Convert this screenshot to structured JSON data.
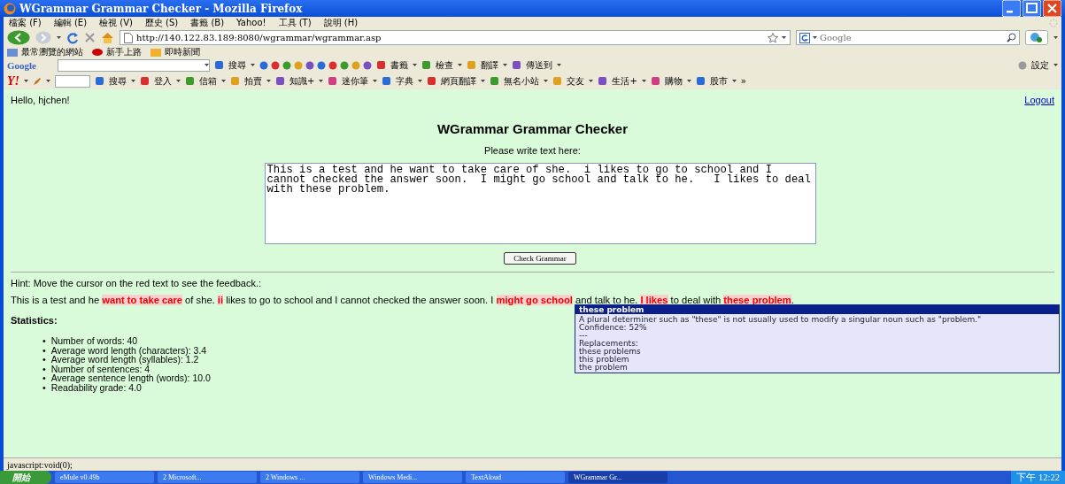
{
  "window": {
    "title": "WGrammar Grammar Checker - Mozilla Firefox"
  },
  "menu": [
    "檔案 (F)",
    "編輯 (E)",
    "檢視 (V)",
    "歷史 (S)",
    "書籤 (B)",
    "Yahoo!",
    "工具 (T)",
    "說明 (H)"
  ],
  "address_bar": {
    "url": "http://140.122.83.189:8080/wgrammar/wgrammar.asp"
  },
  "search_box": {
    "placeholder": "Google"
  },
  "bookmarks": [
    "最常瀏覽的網站",
    "新手上路",
    "即時新聞"
  ],
  "google_toolbar": {
    "logo": "Google",
    "items": [
      "搜尋",
      "書籤",
      "檢查",
      "翻譯",
      "傳送到"
    ],
    "settings": "設定"
  },
  "yahoo_toolbar": {
    "logo": "Y!",
    "items": [
      "搜尋",
      "登入",
      "信箱",
      "拍賣",
      "知識+",
      "迷你筆",
      "字典",
      "網頁翻譯",
      "無名小站",
      "交友",
      "生活+",
      "購物",
      "股市"
    ],
    "more": "»"
  },
  "page": {
    "greeting": "Hello, hjchen!",
    "logout": "Logout",
    "heading": "WGrammar Grammar Checker",
    "prompt": "Please write text here:",
    "input_text": "This is a test and he want to take care of she.  i likes to go to school and I cannot checked the answer soon.  I might go school and talk to he.   I likes to deal with these problem.",
    "button": "Check Grammar",
    "hint": "Hint: Move the cursor on the red text to see the feedback.:",
    "result": "This is a test and he **want to take care** of she. **ii** likes to go to school and I cannot checked the answer soon. I **might go school** and talk to he. **I likes** to deal with **these problem**.",
    "statistics_title": "Statistics:",
    "bullet": "•",
    "statistics": [
      "Number of words: 40",
      "Average word length (characters): 3.4",
      "Average word length (syllables): 1.2",
      "Number of sentences: 4",
      "Average sentence length (words): 10.0",
      "Readability grade: 4.0"
    ]
  },
  "tooltip": {
    "title": "these problem",
    "message": "A plural determiner such as \"these\" is not usually used to modify a singular noun such as \"problem.\"",
    "confidence": "Confidence: 52%",
    "separator": "---",
    "replacements_label": "Replacements:",
    "replacements": [
      "these problems",
      "this problem",
      "the problem"
    ]
  },
  "status_bar": {
    "text": "javascript:void(0);"
  },
  "taskbar": {
    "start": "開始",
    "tasks": [
      {
        "label": "eMule v0.49b",
        "selected": false
      },
      {
        "label": "2 Microsoft...",
        "selected": false
      },
      {
        "label": "2 Windows ...",
        "selected": false
      },
      {
        "label": "Windows Medi...",
        "selected": false
      },
      {
        "label": "TextAloud",
        "selected": false
      },
      {
        "label": "WGrammar Gr...",
        "selected": true
      }
    ],
    "clock": "下午 12:22"
  }
}
